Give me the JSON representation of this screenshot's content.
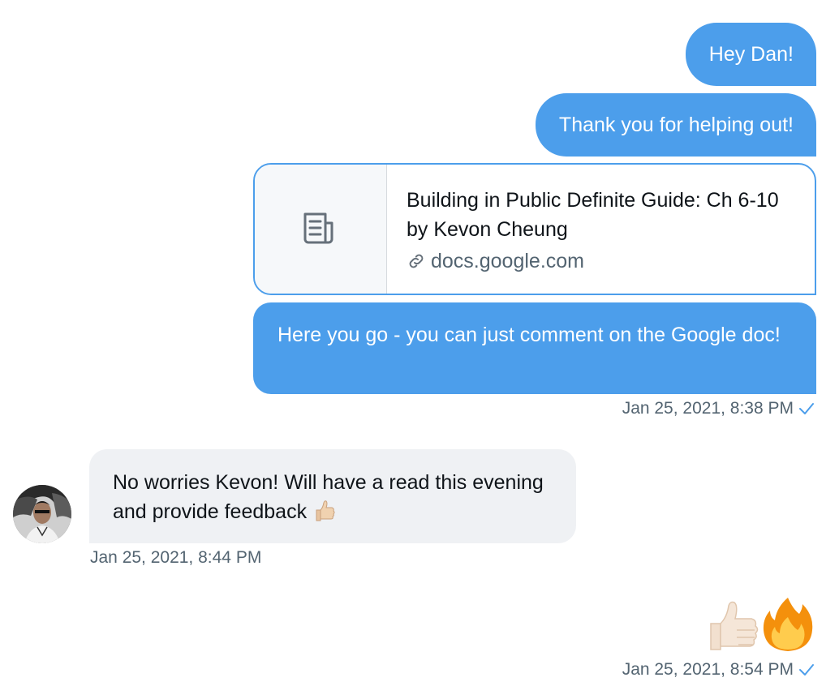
{
  "messages": {
    "m1": {
      "text": "Hey Dan!"
    },
    "m2": {
      "text": "Thank you for helping out!"
    },
    "link_card": {
      "title": "Building in Public Definite Guide: Ch 6-10 by Kevon Cheung",
      "domain": "docs.google.com",
      "thumb_icon": "document-icon",
      "domain_icon": "link-icon"
    },
    "m3": {
      "text": "Here you go - you can just comment on the Google doc!"
    },
    "ts1": {
      "text": "Jan 25, 2021, 8:38 PM"
    },
    "incoming": {
      "text": "No worries Kevon! Will have a read this evening and provide feedback",
      "emoji": "thumbs-up-icon",
      "avatar_icon": "avatar"
    },
    "ts2": {
      "text": "Jan 25, 2021, 8:44 PM"
    },
    "reaction": {
      "icons": [
        "thumbs-up-icon",
        "fire-icon"
      ]
    },
    "ts3": {
      "text": "Jan 25, 2021, 8:54 PM"
    }
  },
  "colors": {
    "outgoing_bubble": "#4c9eeb",
    "incoming_bubble": "#eff1f4",
    "timestamp": "#536471",
    "text_dark": "#0f1419"
  }
}
